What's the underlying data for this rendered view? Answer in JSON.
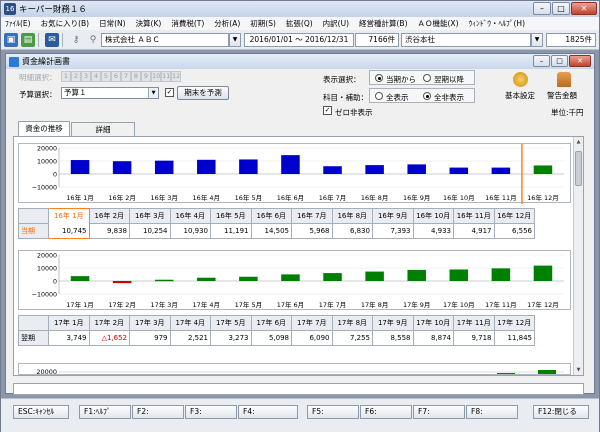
{
  "window": {
    "title": "キーパー財務１６",
    "app_icon": "16"
  },
  "menu": [
    "ﾌｧｲﾙ(E)",
    "お気に入り(B)",
    "日常(N)",
    "決算(K)",
    "消費税(T)",
    "分析(A)",
    "初期(S)",
    "拡張(Q)",
    "内訳(U)",
    "経営種計算(B)",
    "ＡＯ機能(X)",
    "ｳｨﾝﾄﾞｳ・ﾍﾙﾌﾟ(H)"
  ],
  "toolbar": {
    "company": "株式会社 ＡＢＣ",
    "period": "2016/01/01 ～ 2016/12/31",
    "entry_count": "7166件",
    "office": "渋谷本社",
    "other_count": "1825件"
  },
  "child": {
    "title": "資金繰計画書",
    "detail_label": "明細選択：",
    "detail_numbers": [
      "1",
      "2",
      "3",
      "4",
      "5",
      "6",
      "7",
      "8",
      "9",
      "10",
      "11",
      "12"
    ],
    "budget_label": "予算選択：",
    "budget_value": "予算１",
    "predict_button": "期末を予測",
    "display_label": "表示選択：",
    "display_options": [
      "当期から",
      "翌期以降"
    ],
    "subject_label": "科目・補助：",
    "subject_options": [
      "全表示",
      "全非表示"
    ],
    "zero_hide_label": "ゼロ非表示",
    "basic_settings": "基本設定",
    "warning_amount": "警告金額",
    "unit": "単位:千円",
    "tabs": [
      "資金の推移",
      "詳細"
    ]
  },
  "chart_data": [
    {
      "type": "bar",
      "categories": [
        "16年 1月",
        "16年 2月",
        "16年 3月",
        "16年 4月",
        "16年 5月",
        "16年 6月",
        "16年 7月",
        "16年 8月",
        "16年 9月",
        "16年 10月",
        "16年 11月",
        "16年 12月"
      ],
      "series": [
        {
          "values": [
            10745,
            9838,
            10254,
            10930,
            11191,
            14505,
            5968,
            6830,
            7393,
            4933,
            4917,
            6556
          ]
        }
      ],
      "ylim": [
        -10000,
        20000
      ],
      "yticks": [
        "20000",
        "10000",
        "0",
        "−10000"
      ],
      "bar_colors": [
        "#0000cc",
        "#0000cc",
        "#0000cc",
        "#0000cc",
        "#0000cc",
        "#0000cc",
        "#0000cc",
        "#0000cc",
        "#0000cc",
        "#0000cc",
        "#0000cc",
        "#008000"
      ],
      "row_label": "当期",
      "display_values": [
        "10,745",
        "9,838",
        "10,254",
        "10,930",
        "11,191",
        "14,505",
        "5,968",
        "6,830",
        "7,393",
        "4,933",
        "4,917",
        "6,556"
      ],
      "highlight_index": 0
    },
    {
      "type": "bar",
      "categories": [
        "17年 1月",
        "17年 2月",
        "17年 3月",
        "17年 4月",
        "17年 5月",
        "17年 6月",
        "17年 7月",
        "17年 8月",
        "17年 9月",
        "17年 10月",
        "17年 11月",
        "17年 12月"
      ],
      "series": [
        {
          "values": [
            3749,
            -1652,
            979,
            2521,
            3273,
            5098,
            6090,
            7255,
            8558,
            8874,
            9718,
            11845
          ]
        }
      ],
      "ylim": [
        -10000,
        20000
      ],
      "yticks": [
        "20000",
        "10000",
        "0",
        "−10000"
      ],
      "bar_colors": [
        "#008000",
        "#cc0000",
        "#008000",
        "#008000",
        "#008000",
        "#008000",
        "#008000",
        "#008000",
        "#008000",
        "#008000",
        "#008000",
        "#008000"
      ],
      "row_label": "翌期",
      "display_values": [
        "3,749",
        "△1,652",
        "979",
        "2,521",
        "3,273",
        "5,098",
        "6,090",
        "7,255",
        "8,558",
        "8,874",
        "9,718",
        "11,845"
      ]
    }
  ],
  "third_panel": {
    "ytick": "20000",
    "bar_color": "#008000"
  },
  "fkeys": [
    "ESC:ｷｬﾝｾﾙ",
    "F1:ﾍﾙﾌﾟ",
    "F2:",
    "F3:",
    "F4:",
    "F5:",
    "F6:",
    "F7:",
    "F8:",
    "F12:閉じる"
  ]
}
